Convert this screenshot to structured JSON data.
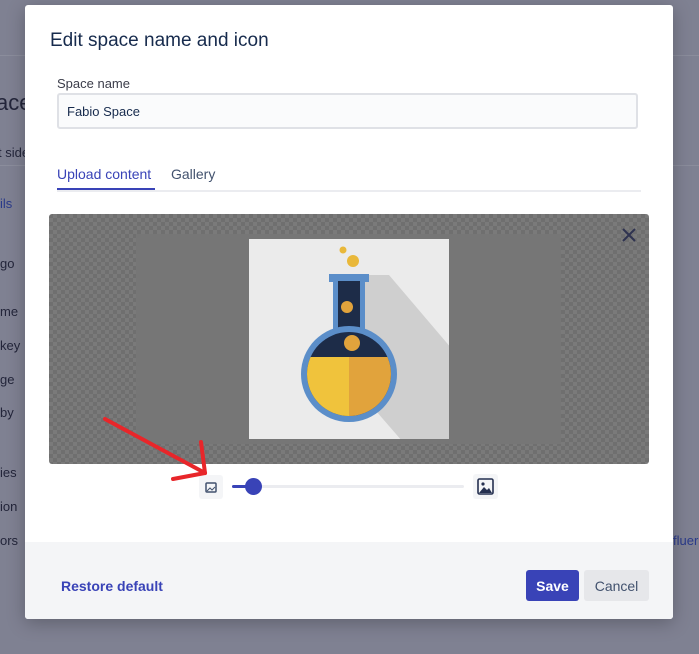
{
  "background": {
    "title_fragment": "ace",
    "side_fragment": "t side",
    "items": [
      "ils",
      "go",
      "me",
      "key",
      "ge",
      "by",
      "ies",
      "ion",
      "ors"
    ],
    "right_fragment": "fluer"
  },
  "modal": {
    "title": "Edit space name and icon",
    "space_name_label": "Space name",
    "space_name_value": "Fabio Space",
    "tabs": [
      {
        "label": "Upload content",
        "active": true
      },
      {
        "label": "Gallery",
        "active": false
      }
    ],
    "editor": {
      "close_icon": "close-icon",
      "preview_icon": "flask-icon",
      "zoom": {
        "min_icon": "image-small-icon",
        "max_icon": "image-large-icon",
        "value": 0.06
      }
    },
    "footer": {
      "restore_label": "Restore default",
      "save_label": "Save",
      "cancel_label": "Cancel"
    }
  },
  "colors": {
    "accent": "#3943b7",
    "overlay": "#7f8192",
    "annotation": "#e8262a",
    "flask_dark": "#1d2c48",
    "flask_yellow": "#f0c33c",
    "flask_orange": "#e1a33c",
    "flask_outline": "#5b8ec9"
  }
}
